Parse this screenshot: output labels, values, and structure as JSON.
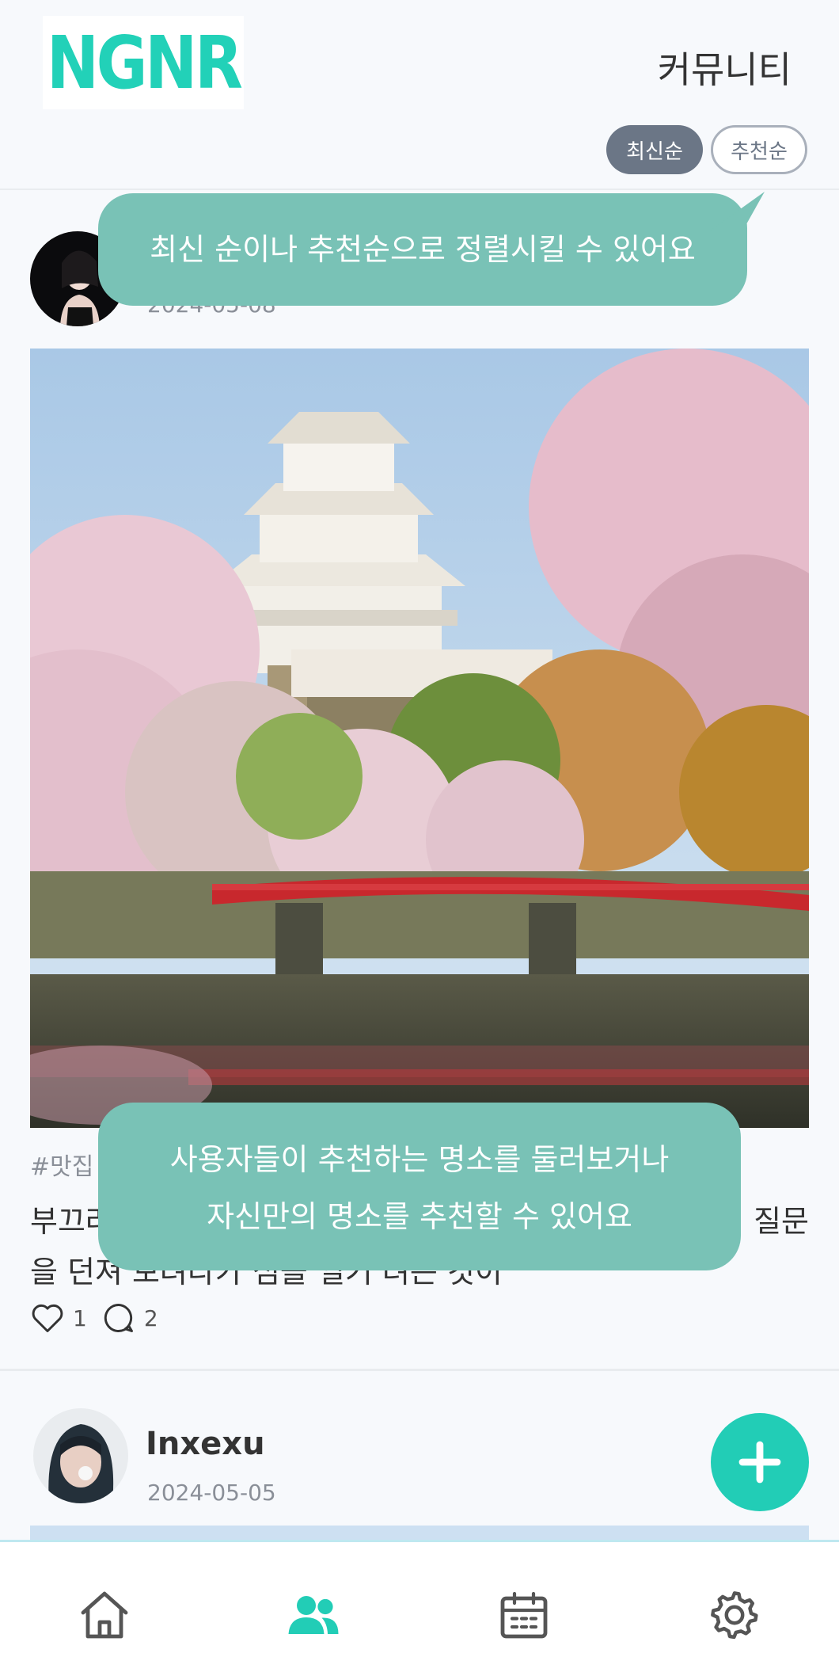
{
  "header": {
    "logo_text": "NGNR",
    "title": "커뮤니티",
    "sort": {
      "latest": "최신순",
      "recommend": "추천순",
      "selected": "latest"
    }
  },
  "posts": [
    {
      "date": "2024-05-08",
      "tag": "#맛집",
      "text_line1": "부끄러",
      "text_line1_end": "질문",
      "text_line2": "을 던져 보려다가 섬을 얼기 려는 것이",
      "likes": "1",
      "comments": "2"
    },
    {
      "username": "Inxexu",
      "date": "2024-05-05"
    }
  ],
  "callouts": {
    "sort_hint": "최신 순이나 추천순으로 정렬시킬 수 있어요",
    "feed_hint_line1": "사용자들이 추천하는 명소를 둘러보거나",
    "feed_hint_line2": "자신만의 명소를 추천할 수 있어요"
  },
  "tabbar": {
    "items": [
      "home-icon",
      "community-icon",
      "calendar-icon",
      "settings-icon"
    ],
    "active": "community-icon"
  },
  "colors": {
    "accent": "#22cdb6",
    "callout": "#79c2b6",
    "sort_active": "#6b7686"
  }
}
